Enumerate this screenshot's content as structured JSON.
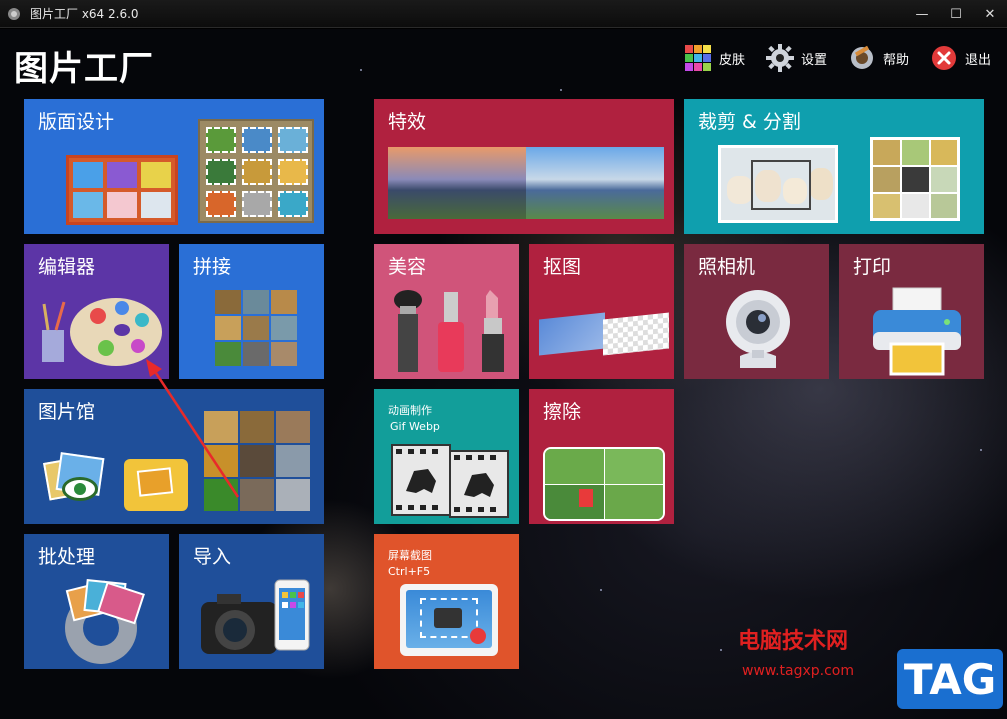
{
  "window": {
    "title": "图片工厂 x64 2.6.0",
    "controls": {
      "minimize": "—",
      "maximize": "☐",
      "close": "✕"
    }
  },
  "app": {
    "title": "图片工厂"
  },
  "toolbar": {
    "skin": {
      "label": "皮肤",
      "icon": "skin-grid-icon"
    },
    "settings": {
      "label": "设置",
      "icon": "gear-icon"
    },
    "help": {
      "label": "帮助",
      "icon": "help-gear-icon"
    },
    "exit": {
      "label": "退出",
      "icon": "close-circle-icon"
    }
  },
  "tiles": {
    "layout": {
      "label": "版面设计",
      "color": "#2a6fd6"
    },
    "editor": {
      "label": "编辑器",
      "color": "#5c35a6"
    },
    "stitch": {
      "label": "拼接",
      "color": "#2a6fd6"
    },
    "gallery": {
      "label": "图片馆",
      "color": "#1f4f9a"
    },
    "batch": {
      "label": "批处理",
      "color": "#1f4f9a"
    },
    "import": {
      "label": "导入",
      "color": "#1f4f9a"
    },
    "effects": {
      "label": "特效",
      "color": "#b0213f"
    },
    "beauty": {
      "label": "美容",
      "color": "#d0547a"
    },
    "cutout": {
      "label": "抠图",
      "color": "#b0213f"
    },
    "animation": {
      "label": "动画制作",
      "sublabel": "Gif Webp",
      "color": "#129e9a"
    },
    "erase": {
      "label": "擦除",
      "color": "#b0213f"
    },
    "screenshot": {
      "label": "屏幕截图",
      "sublabel": "Ctrl+F5",
      "color": "#e0542b"
    },
    "crop": {
      "label": "裁剪 & 分割",
      "color": "#0f9fae"
    },
    "camera": {
      "label": "照相机",
      "color": "#7a2a40"
    },
    "print": {
      "label": "打印",
      "color": "#7a2a40"
    }
  },
  "watermark": {
    "brand": "电脑技术网",
    "url": "www.tagxp.com",
    "tag": "TAG"
  }
}
